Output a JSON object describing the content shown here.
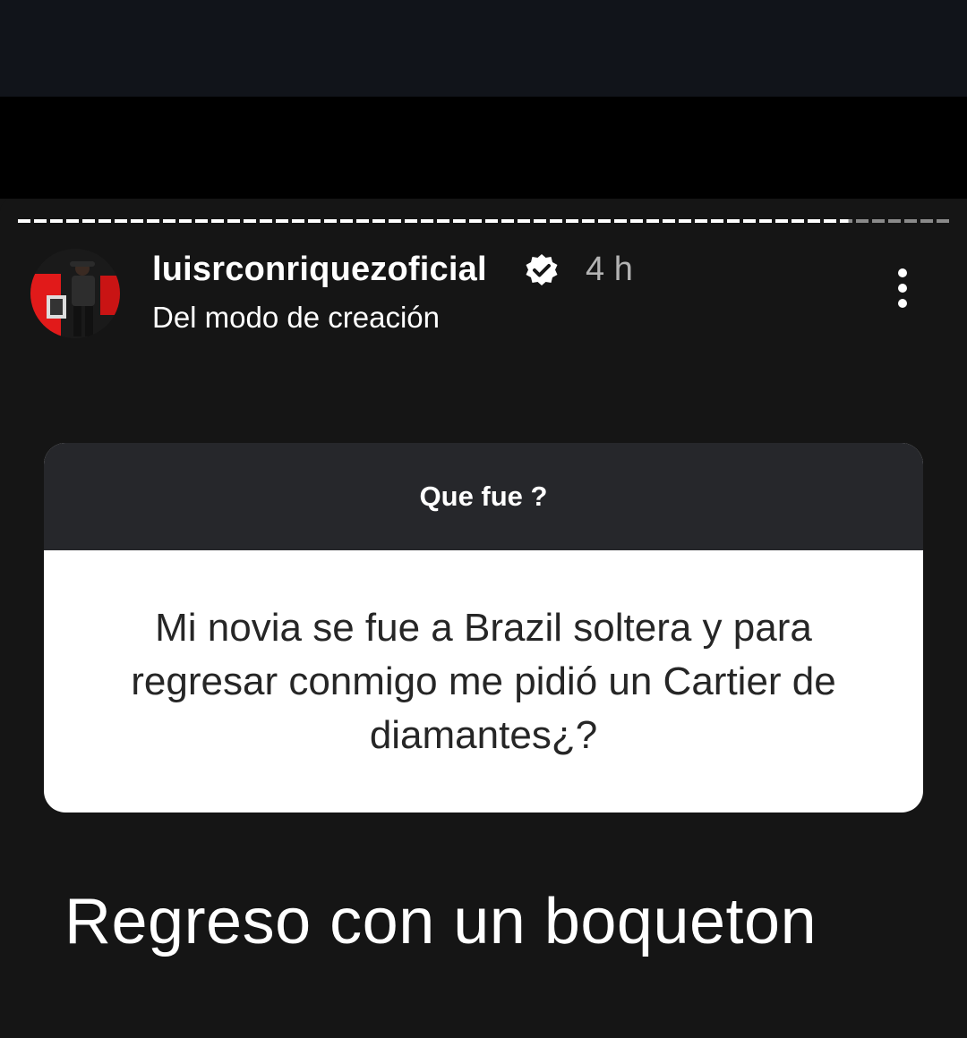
{
  "colors": {
    "background": "#151515",
    "top_bar": "#11141a",
    "question_header": "#26272b",
    "progress_seen": "#ffffff",
    "progress_unseen": "#8a8a8a",
    "verified_badge": "#ffffff"
  },
  "story": {
    "progress": {
      "segments_total": 2,
      "segments_seen": 1,
      "current_fraction": 0.89
    },
    "author": {
      "username": "luisrconriquezoficial",
      "verified": true,
      "verified_icon": "verified-badge-icon",
      "time": "4 h",
      "subtitle": "Del modo de creación"
    },
    "more_icon": "more-vertical-icon",
    "question_sticker": {
      "prompt": "Que fue ?",
      "question": "Mi novia se fue a Brazil soltera y para regresar conmigo me pidió un Cartier de diamantes¿?"
    },
    "answer_text": "Regreso con un boqueton"
  }
}
